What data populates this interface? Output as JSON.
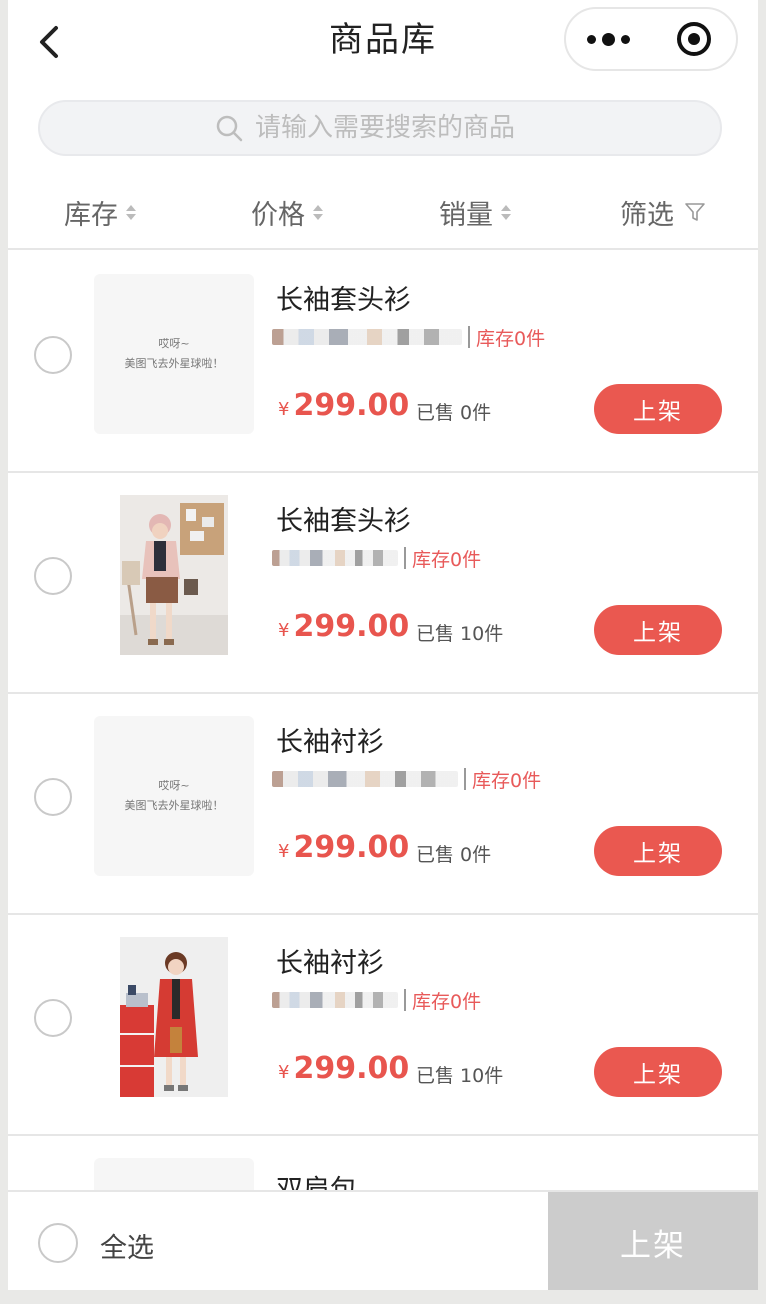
{
  "nav": {
    "title": "商品库",
    "back_icon": "chevron-left-icon",
    "more_icon": "more-dots-icon",
    "close_icon": "target-circle-icon"
  },
  "search": {
    "placeholder": "请输入需要搜索的商品",
    "icon": "search-icon"
  },
  "sort": [
    {
      "label": "库存",
      "icon": "sort-arrows-icon"
    },
    {
      "label": "价格",
      "icon": "sort-arrows-icon"
    },
    {
      "label": "销量",
      "icon": "sort-arrows-icon"
    },
    {
      "label": "筛选",
      "icon": "filter-funnel-icon"
    }
  ],
  "placeholder_image": {
    "line1": "哎呀~",
    "line2": "美图飞去外星球啦！"
  },
  "products": [
    {
      "name": "长袖套头衫",
      "stock": "库存0件",
      "currency": "¥",
      "price": "299.00",
      "sold": "已售 0件",
      "button": "上架",
      "image": "placeholder"
    },
    {
      "name": "长袖套头衫",
      "stock": "库存0件",
      "currency": "¥",
      "price": "299.00",
      "sold": "已售 10件",
      "button": "上架",
      "image": "photo-pink-outfit"
    },
    {
      "name": "长袖衬衫",
      "stock": "库存0件",
      "currency": "¥",
      "price": "299.00",
      "sold": "已售 0件",
      "button": "上架",
      "image": "placeholder"
    },
    {
      "name": "长袖衬衫",
      "stock": "库存0件",
      "currency": "¥",
      "price": "299.00",
      "sold": "已售 10件",
      "button": "上架",
      "image": "photo-red-coat"
    },
    {
      "name": "双肩包",
      "image": "placeholder"
    }
  ],
  "bottom": {
    "select_all": "全选",
    "shelf_button": "上架"
  },
  "colors": {
    "accent": "#ea5850",
    "price": "#e8554e",
    "disabled": "#cccccc"
  }
}
